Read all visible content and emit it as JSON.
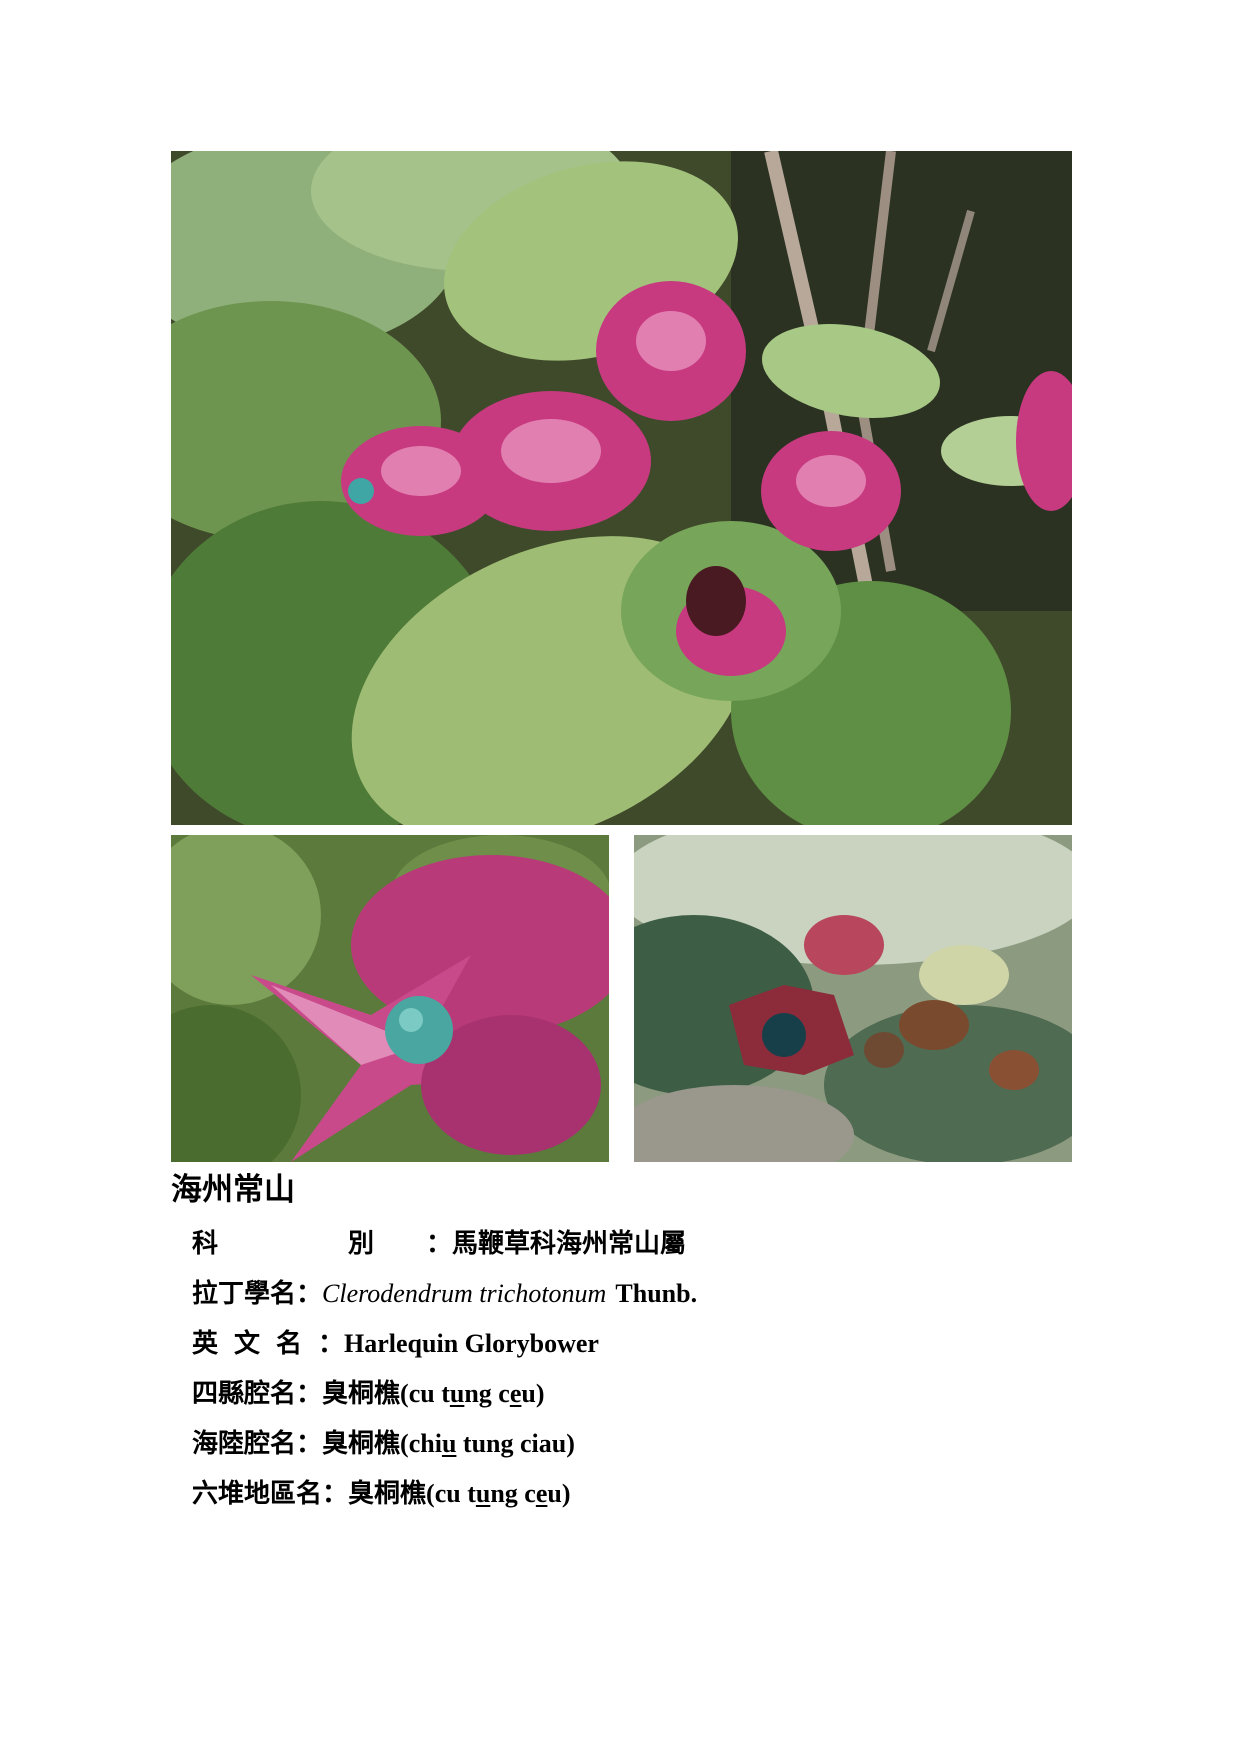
{
  "plant": {
    "name": "海州常山",
    "family_label": "科　別",
    "family_value": "馬鞭草科海州常山屬",
    "latin_label": "拉丁學名",
    "latin_italic": "Clerodendrum trichotonum",
    "latin_author": "Thunb.",
    "english_label": "英文名",
    "english_value": "Harlequin Glorybower",
    "sixian_label": "四縣腔名",
    "sixian_cjk": "臭桐樵",
    "sixian_roman": [
      "(cu t",
      "u",
      "ng c",
      "e",
      "u)"
    ],
    "hailu_label": "海陸腔名",
    "hailu_cjk": "臭桐樵",
    "hailu_roman": [
      "(chi",
      "u",
      " tung ciau)"
    ],
    "liudui_label": "六堆地區名",
    "liudui_cjk": "臭桐樵",
    "liudui_roman": [
      "(cu t",
      "u",
      "ng c",
      "e",
      "u)"
    ],
    "colon": "："
  }
}
